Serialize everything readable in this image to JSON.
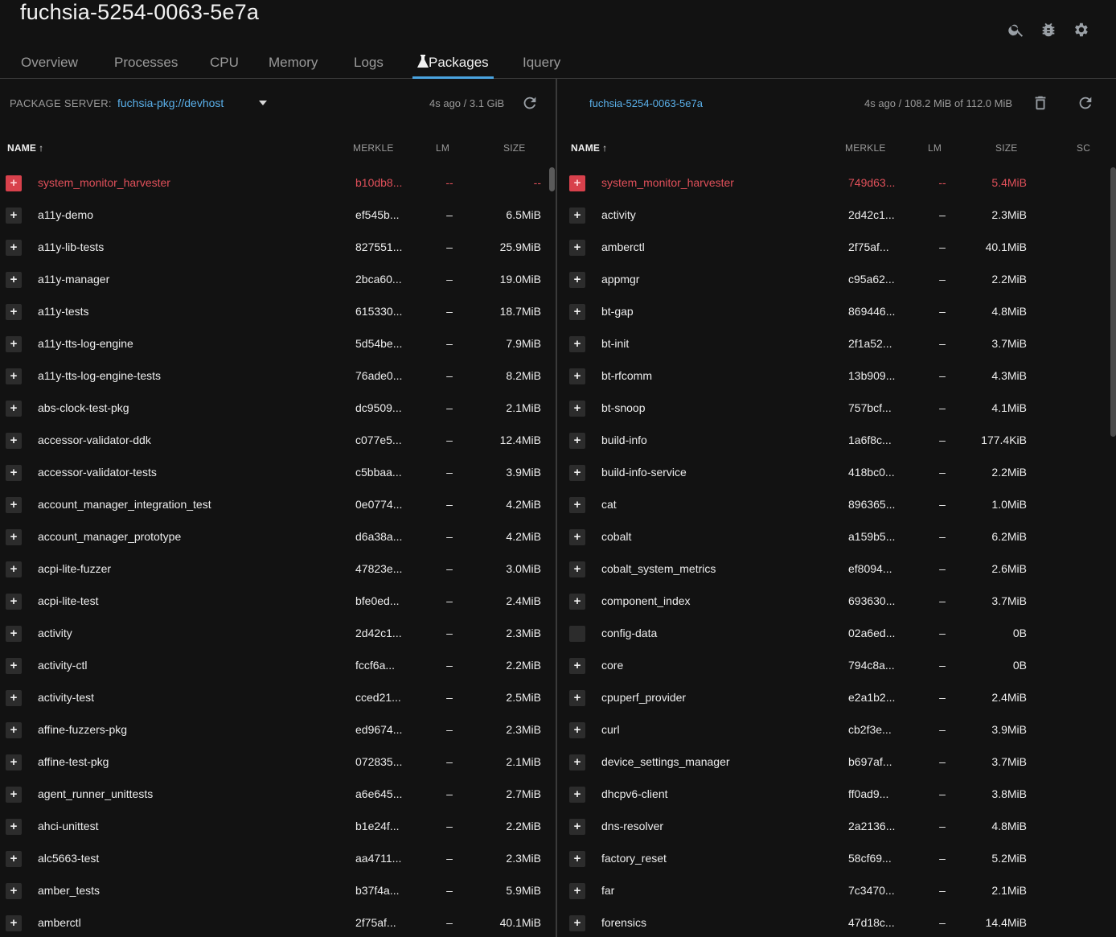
{
  "header": {
    "title": "fuchsia-5254-0063-5e7a",
    "icons": [
      "search-icon",
      "bug-icon",
      "settings-icon"
    ]
  },
  "tabs": [
    {
      "label": "Overview",
      "active": false
    },
    {
      "label": "Processes",
      "active": false
    },
    {
      "label": "CPU",
      "active": false
    },
    {
      "label": "Memory",
      "active": false
    },
    {
      "label": "Logs",
      "active": false
    },
    {
      "label": "Packages",
      "active": true,
      "icon": "flask-icon"
    },
    {
      "label": "Iquery",
      "active": false
    }
  ],
  "left": {
    "server_label": "PACKAGE SERVER:",
    "server_value": "fuchsia-pkg://devhost",
    "status": "4s ago / 3.1 GiB",
    "columns": {
      "name": "NAME",
      "merkle": "MERKLE",
      "lm": "LM",
      "size": "SIZE"
    },
    "rows": [
      {
        "name": "system_monitor_harvester",
        "merkle": "b10db8...",
        "lm": "--",
        "size": "--",
        "error": true
      },
      {
        "name": "a11y-demo",
        "merkle": "ef545b...",
        "lm": "–",
        "size": "6.5MiB"
      },
      {
        "name": "a11y-lib-tests",
        "merkle": "827551...",
        "lm": "–",
        "size": "25.9MiB"
      },
      {
        "name": "a11y-manager",
        "merkle": "2bca60...",
        "lm": "–",
        "size": "19.0MiB"
      },
      {
        "name": "a11y-tests",
        "merkle": "615330...",
        "lm": "–",
        "size": "18.7MiB"
      },
      {
        "name": "a11y-tts-log-engine",
        "merkle": "5d54be...",
        "lm": "–",
        "size": "7.9MiB"
      },
      {
        "name": "a11y-tts-log-engine-tests",
        "merkle": "76ade0...",
        "lm": "–",
        "size": "8.2MiB"
      },
      {
        "name": "abs-clock-test-pkg",
        "merkle": "dc9509...",
        "lm": "–",
        "size": "2.1MiB"
      },
      {
        "name": "accessor-validator-ddk",
        "merkle": "c077e5...",
        "lm": "–",
        "size": "12.4MiB"
      },
      {
        "name": "accessor-validator-tests",
        "merkle": "c5bbaa...",
        "lm": "–",
        "size": "3.9MiB"
      },
      {
        "name": "account_manager_integration_test",
        "merkle": "0e0774...",
        "lm": "–",
        "size": "4.2MiB"
      },
      {
        "name": "account_manager_prototype",
        "merkle": "d6a38a...",
        "lm": "–",
        "size": "4.2MiB"
      },
      {
        "name": "acpi-lite-fuzzer",
        "merkle": "47823e...",
        "lm": "–",
        "size": "3.0MiB"
      },
      {
        "name": "acpi-lite-test",
        "merkle": "bfe0ed...",
        "lm": "–",
        "size": "2.4MiB"
      },
      {
        "name": "activity",
        "merkle": "2d42c1...",
        "lm": "–",
        "size": "2.3MiB"
      },
      {
        "name": "activity-ctl",
        "merkle": "fccf6a...",
        "lm": "–",
        "size": "2.2MiB"
      },
      {
        "name": "activity-test",
        "merkle": "cced21...",
        "lm": "–",
        "size": "2.5MiB"
      },
      {
        "name": "affine-fuzzers-pkg",
        "merkle": "ed9674...",
        "lm": "–",
        "size": "2.3MiB"
      },
      {
        "name": "affine-test-pkg",
        "merkle": "072835...",
        "lm": "–",
        "size": "2.1MiB"
      },
      {
        "name": "agent_runner_unittests",
        "merkle": "a6e645...",
        "lm": "–",
        "size": "2.7MiB"
      },
      {
        "name": "ahci-unittest",
        "merkle": "b1e24f...",
        "lm": "–",
        "size": "2.2MiB"
      },
      {
        "name": "alc5663-test",
        "merkle": "aa4711...",
        "lm": "–",
        "size": "2.3MiB"
      },
      {
        "name": "amber_tests",
        "merkle": "b37f4a...",
        "lm": "–",
        "size": "5.9MiB"
      },
      {
        "name": "amberctl",
        "merkle": "2f75af...",
        "lm": "–",
        "size": "40.1MiB"
      }
    ]
  },
  "right": {
    "device": "fuchsia-5254-0063-5e7a",
    "status": "4s ago / 108.2 MiB of 112.0 MiB",
    "columns": {
      "name": "NAME",
      "merkle": "MERKLE",
      "lm": "LM",
      "size": "SIZE",
      "sc": "SC"
    },
    "rows": [
      {
        "name": "system_monitor_harvester",
        "merkle": "749d63...",
        "lm": "--",
        "size": "5.4MiB",
        "error": true
      },
      {
        "name": "activity",
        "merkle": "2d42c1...",
        "lm": "–",
        "size": "2.3MiB"
      },
      {
        "name": "amberctl",
        "merkle": "2f75af...",
        "lm": "–",
        "size": "40.1MiB"
      },
      {
        "name": "appmgr",
        "merkle": "c95a62...",
        "lm": "–",
        "size": "2.2MiB"
      },
      {
        "name": "bt-gap",
        "merkle": "869446...",
        "lm": "–",
        "size": "4.8MiB"
      },
      {
        "name": "bt-init",
        "merkle": "2f1a52...",
        "lm": "–",
        "size": "3.7MiB"
      },
      {
        "name": "bt-rfcomm",
        "merkle": "13b909...",
        "lm": "–",
        "size": "4.3MiB"
      },
      {
        "name": "bt-snoop",
        "merkle": "757bcf...",
        "lm": "–",
        "size": "4.1MiB"
      },
      {
        "name": "build-info",
        "merkle": "1a6f8c...",
        "lm": "–",
        "size": "177.4KiB"
      },
      {
        "name": "build-info-service",
        "merkle": "418bc0...",
        "lm": "–",
        "size": "2.2MiB"
      },
      {
        "name": "cat",
        "merkle": "896365...",
        "lm": "–",
        "size": "1.0MiB"
      },
      {
        "name": "cobalt",
        "merkle": "a159b5...",
        "lm": "–",
        "size": "6.2MiB"
      },
      {
        "name": "cobalt_system_metrics",
        "merkle": "ef8094...",
        "lm": "–",
        "size": "2.6MiB"
      },
      {
        "name": "component_index",
        "merkle": "693630...",
        "lm": "–",
        "size": "3.7MiB"
      },
      {
        "name": "config-data",
        "merkle": "02a6ed...",
        "lm": "–",
        "size": "0B",
        "no_expand": true
      },
      {
        "name": "core",
        "merkle": "794c8a...",
        "lm": "–",
        "size": "0B"
      },
      {
        "name": "cpuperf_provider",
        "merkle": "e2a1b2...",
        "lm": "–",
        "size": "2.4MiB"
      },
      {
        "name": "curl",
        "merkle": "cb2f3e...",
        "lm": "–",
        "size": "3.9MiB"
      },
      {
        "name": "device_settings_manager",
        "merkle": "b697af...",
        "lm": "–",
        "size": "3.7MiB"
      },
      {
        "name": "dhcpv6-client",
        "merkle": "ff0ad9...",
        "lm": "–",
        "size": "3.8MiB"
      },
      {
        "name": "dns-resolver",
        "merkle": "2a2136...",
        "lm": "–",
        "size": "4.8MiB"
      },
      {
        "name": "factory_reset",
        "merkle": "58cf69...",
        "lm": "–",
        "size": "5.2MiB"
      },
      {
        "name": "far",
        "merkle": "7c3470...",
        "lm": "–",
        "size": "2.1MiB"
      },
      {
        "name": "forensics",
        "merkle": "47d18c...",
        "lm": "–",
        "size": "14.4MiB"
      }
    ]
  },
  "colors": {
    "accent": "#4aa3df",
    "link": "#5ab0ea",
    "error": "#e0505a",
    "error_button": "#d8414c",
    "background": "#121212"
  }
}
